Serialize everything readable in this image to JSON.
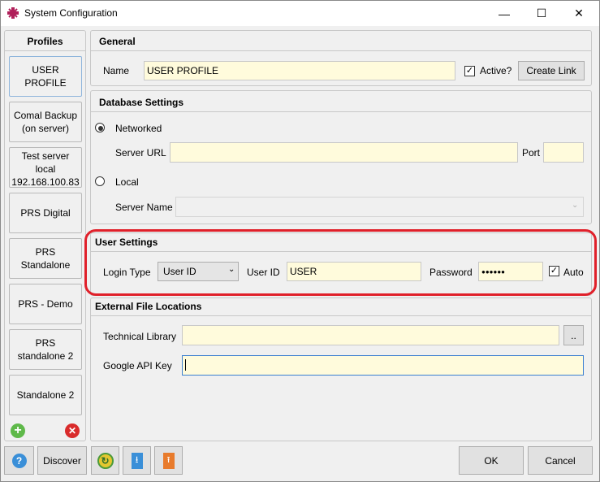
{
  "window": {
    "title": "System Configuration",
    "minimize_glyph": "—",
    "maximize_glyph": "☐",
    "close_glyph": "✕"
  },
  "profiles": {
    "header": "Profiles",
    "items": [
      {
        "label": "USER PROFILE"
      },
      {
        "label": "Comal Backup\n(on server)"
      },
      {
        "label": "Test server\nlocal\n192.168.100.83"
      },
      {
        "label": "PRS Digital"
      },
      {
        "label": "PRS\nStandalone"
      },
      {
        "label": "PRS - Demo"
      },
      {
        "label": "PRS\nstandalone 2"
      },
      {
        "label": "Standalone 2"
      }
    ],
    "add_icon": "add-icon",
    "remove_icon": "remove-icon"
  },
  "general": {
    "header": "General",
    "name_label": "Name",
    "name_value": "USER PROFILE",
    "active_label": "Active?",
    "active_checked": true,
    "create_link_label": "Create Link"
  },
  "database": {
    "header": "Database Settings",
    "networked_label": "Networked",
    "networked_selected": true,
    "server_url_label": "Server URL",
    "server_url_value": "",
    "port_label": "Port",
    "port_value": "",
    "local_label": "Local",
    "local_selected": false,
    "server_name_label": "Server Name",
    "server_name_value": ""
  },
  "user_settings": {
    "header": "User Settings",
    "login_type_label": "Login Type",
    "login_type_value": "User ID",
    "user_id_label": "User ID",
    "user_id_value": "USER",
    "password_label": "Password",
    "password_value": "●●●●●●",
    "auto_label": "Auto",
    "auto_checked": true,
    "highlight_color": "#e0202a"
  },
  "external": {
    "header": "External File Locations",
    "tech_library_label": "Technical Library",
    "tech_library_value": "",
    "browse_label": "..",
    "google_key_label": "Google API Key",
    "google_key_value": ""
  },
  "footer": {
    "discover_label": "Discover",
    "ok_label": "OK",
    "cancel_label": "Cancel"
  }
}
